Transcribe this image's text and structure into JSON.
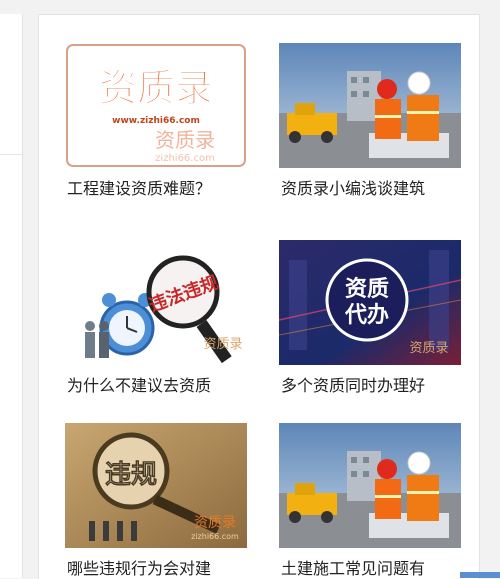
{
  "articles": [
    {
      "title": "工程建设资质难题？",
      "thumb": {
        "headline": "资质录",
        "url": "www.zizhi66.com",
        "subline": "资质录",
        "watermark": "zizhi66.com"
      }
    },
    {
      "title": "资质录小编浅谈建筑",
      "thumb": {}
    },
    {
      "title": "为什么不建议去资质",
      "thumb": {
        "sign": "违法违规",
        "watermark": "资质录"
      }
    },
    {
      "title": "多个资质同时办理好",
      "thumb": {
        "line1": "资质",
        "line2": "代办",
        "watermark": "资质录"
      }
    },
    {
      "title": "哪些违规行为会对建",
      "thumb": {
        "headline": "违规",
        "watermark": "资质录",
        "watermark_sub": "zizhi66.com"
      }
    },
    {
      "title": "土建施工常见问题有",
      "thumb": {}
    }
  ],
  "colors": {
    "brand_orange": "#e8561c",
    "accent_blue": "#5b8fcf",
    "text": "#222222"
  }
}
